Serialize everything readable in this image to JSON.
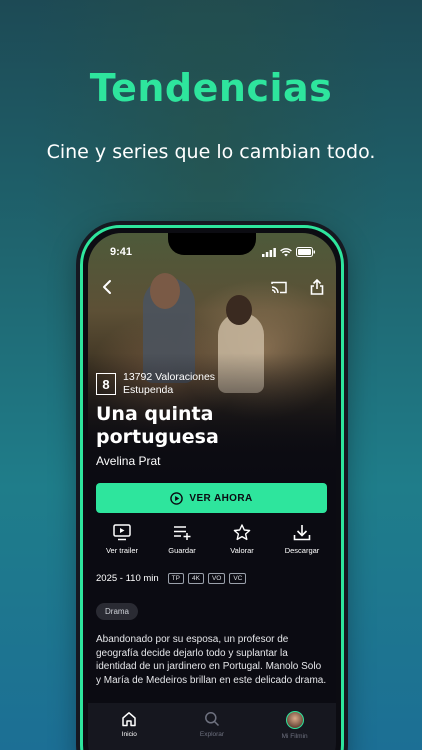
{
  "promo": {
    "headline": "Tendencias",
    "subheadline": "Cine y series que lo cambian todo."
  },
  "status": {
    "time": "9:41"
  },
  "movie": {
    "rating": "8",
    "ratings_count": "13792 Valoraciones",
    "rating_label": "Estupenda",
    "title": "Una quinta portuguesa",
    "director": "Avelina Prat",
    "watch_label": "VER AHORA",
    "year_duration": "2025 - 110 min",
    "badges": [
      "TP",
      "4K",
      "VO",
      "VC"
    ],
    "genre": "Drama",
    "synopsis": "Abandonado por su esposa, un profesor de geografía decide dejarlo todo y suplantar la identidad de un jardinero en Portugal. Manolo Solo y María de Medeiros brillan en este delicado drama."
  },
  "actions": [
    {
      "label": "Ver trailer",
      "icon": "trailer-icon"
    },
    {
      "label": "Guardar",
      "icon": "playlist-add-icon"
    },
    {
      "label": "Valorar",
      "icon": "star-icon"
    },
    {
      "label": "Descargar",
      "icon": "download-icon"
    }
  ],
  "tabs": [
    {
      "label": "Inicio",
      "icon": "home-icon",
      "active": true
    },
    {
      "label": "Explorar",
      "icon": "search-icon",
      "active": false
    },
    {
      "label": "Mi Filmin",
      "icon": "avatar",
      "active": false
    }
  ],
  "colors": {
    "accent": "#2ee59d",
    "background": "#0b0b12"
  }
}
